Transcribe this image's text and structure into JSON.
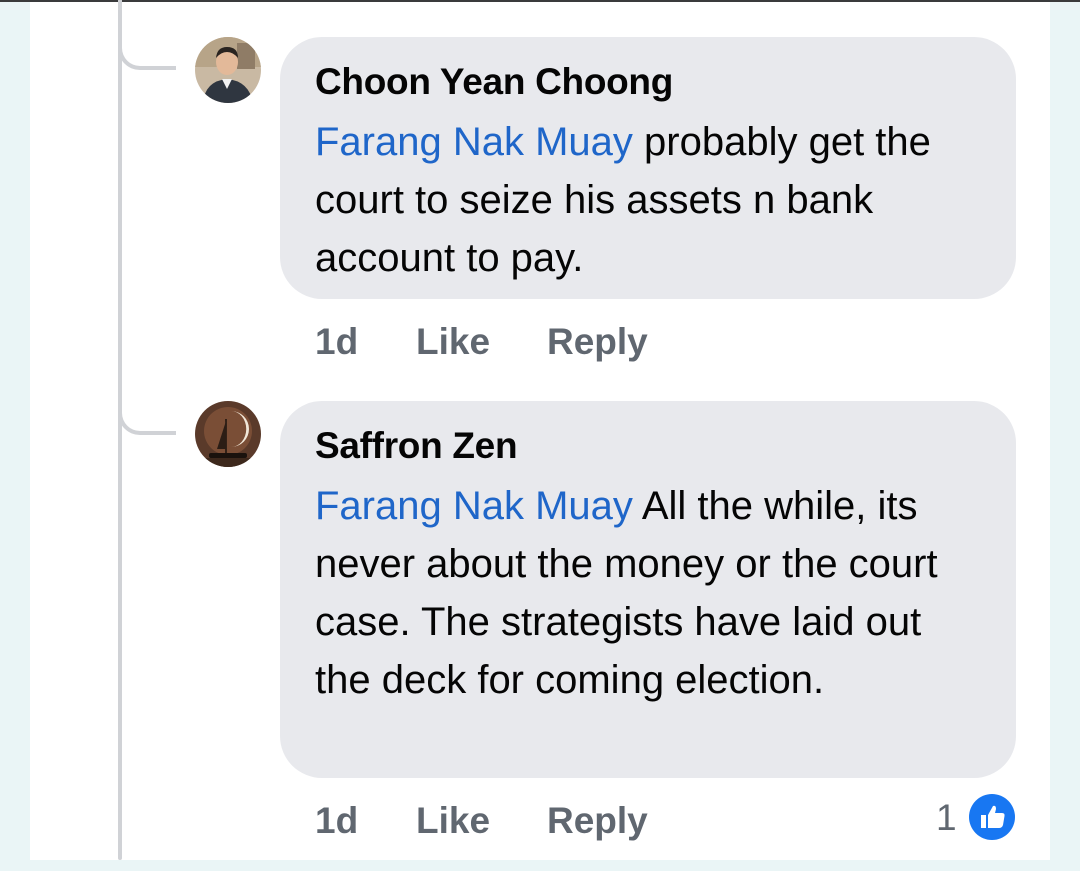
{
  "comments": [
    {
      "author": "Choon Yean Choong",
      "mention": "Farang Nak Muay",
      "text": " probably get the court to seize his assets n bank account to pay.",
      "time": "1d",
      "like_label": "Like",
      "reply_label": "Reply",
      "avatar_icon": "person-photo-icon"
    },
    {
      "author": "Saffron Zen",
      "mention": "Farang Nak Muay",
      "text": " All the while, its never about the money or the court case. The strategists have laid out the deck for coming election.",
      "time": "1d",
      "like_label": "Like",
      "reply_label": "Reply",
      "avatar_icon": "moon-sailboat-icon",
      "reaction_count": "1",
      "reaction_icon": "thumbs-up-icon"
    }
  ],
  "colors": {
    "mention": "#1f66c9",
    "bubble": "#e8e9ed",
    "meta": "#606770",
    "like_badge": "#1877f2"
  }
}
